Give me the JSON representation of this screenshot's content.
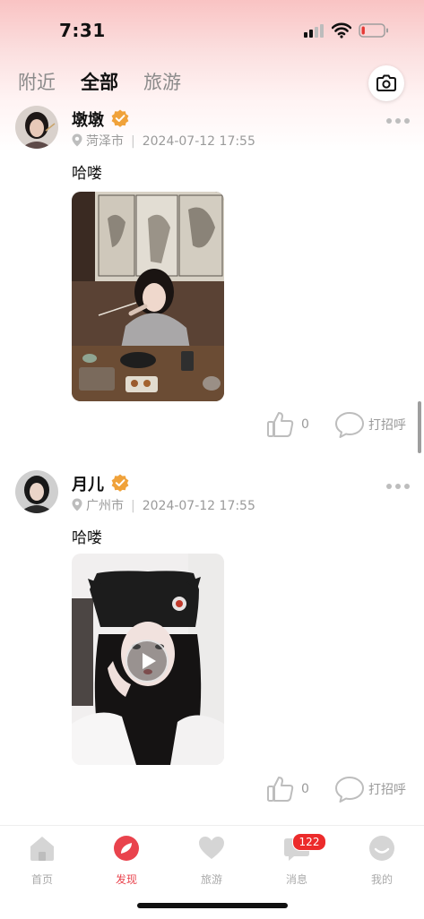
{
  "status_bar": {
    "time": "7:31",
    "battery_level": 0.15,
    "battery_color": "#e53935"
  },
  "tabs": [
    {
      "label": "附近",
      "active": false
    },
    {
      "label": "全部",
      "active": true
    },
    {
      "label": "旅游",
      "active": false
    }
  ],
  "camera_icon": "camera-icon",
  "posts": [
    {
      "username": "墩墩",
      "verified": true,
      "location": "菏泽市",
      "timestamp": "2024-07-12 17:55",
      "text": "哈喽",
      "media_type": "photo",
      "like_count": "0",
      "greet_label": "打招呼"
    },
    {
      "username": "月儿",
      "verified": true,
      "location": "广州市",
      "timestamp": "2024-07-12 17:55",
      "text": "哈喽",
      "media_type": "video",
      "like_count": "0",
      "greet_label": "打招呼"
    }
  ],
  "bottom_nav": [
    {
      "label": "首页",
      "icon": "home-icon",
      "active": false
    },
    {
      "label": "发现",
      "icon": "discover-icon",
      "active": true
    },
    {
      "label": "旅游",
      "icon": "heart-icon",
      "active": false
    },
    {
      "label": "消息",
      "icon": "message-icon",
      "active": false,
      "badge": "122"
    },
    {
      "label": "我的",
      "icon": "profile-icon",
      "active": false
    }
  ],
  "colors": {
    "accent": "#e9434d",
    "verified": "#f0a23a",
    "badge": "#ec2b2b"
  }
}
